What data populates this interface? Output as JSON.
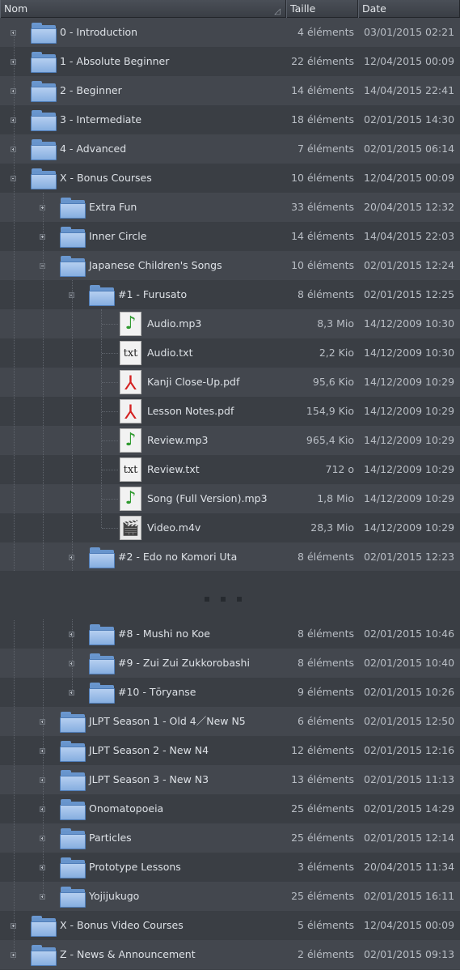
{
  "header": {
    "name": "Nom",
    "size": "Taille",
    "date": "Date",
    "sort_icon": "sort-indicator-icon"
  },
  "rows": [
    {
      "level": 0,
      "type": "folder",
      "toggle": "plus",
      "name": "0 - Introduction",
      "size": "4 éléments",
      "date": "03/01/2015 02:21"
    },
    {
      "level": 0,
      "type": "folder",
      "toggle": "plus",
      "name": "1 - Absolute Beginner",
      "size": "22 éléments",
      "date": "12/04/2015 00:09"
    },
    {
      "level": 0,
      "type": "folder",
      "toggle": "plus",
      "name": "2 - Beginner",
      "size": "14 éléments",
      "date": "14/04/2015 22:41"
    },
    {
      "level": 0,
      "type": "folder",
      "toggle": "plus",
      "name": "3 - Intermediate",
      "size": "18 éléments",
      "date": "02/01/2015 14:30"
    },
    {
      "level": 0,
      "type": "folder",
      "toggle": "plus",
      "name": "4 - Advanced",
      "size": "7 éléments",
      "date": "02/01/2015 06:14"
    },
    {
      "level": 0,
      "type": "folder",
      "toggle": "minus",
      "name": "X - Bonus Courses",
      "size": "10 éléments",
      "date": "12/04/2015 00:09"
    },
    {
      "level": 1,
      "type": "folder",
      "toggle": "plus",
      "name": "Extra Fun",
      "size": "33 éléments",
      "date": "20/04/2015 12:32"
    },
    {
      "level": 1,
      "type": "folder",
      "toggle": "plus",
      "name": "Inner Circle",
      "size": "14 éléments",
      "date": "14/04/2015 22:03"
    },
    {
      "level": 1,
      "type": "folder",
      "toggle": "minus",
      "name": "Japanese Children's Songs",
      "size": "10 éléments",
      "date": "02/01/2015 12:24"
    },
    {
      "level": 2,
      "type": "folder",
      "toggle": "minus",
      "name": "#1 - Furusato",
      "size": "8 éléments",
      "date": "02/01/2015 12:25"
    },
    {
      "level": 3,
      "type": "mp3",
      "name": "Audio.mp3",
      "size": "8,3 Mio",
      "date": "14/12/2009 10:30"
    },
    {
      "level": 3,
      "type": "txt",
      "name": "Audio.txt",
      "size": "2,2 Kio",
      "date": "14/12/2009 10:30"
    },
    {
      "level": 3,
      "type": "pdf",
      "name": "Kanji Close-Up.pdf",
      "size": "95,6 Kio",
      "date": "14/12/2009 10:29"
    },
    {
      "level": 3,
      "type": "pdf",
      "name": "Lesson Notes.pdf",
      "size": "154,9 Kio",
      "date": "14/12/2009 10:29"
    },
    {
      "level": 3,
      "type": "mp3",
      "name": "Review.mp3",
      "size": "965,4 Kio",
      "date": "14/12/2009 10:29"
    },
    {
      "level": 3,
      "type": "txt",
      "name": "Review.txt",
      "size": "712 o",
      "date": "14/12/2009 10:29"
    },
    {
      "level": 3,
      "type": "mp3",
      "name": "Song (Full Version).mp3",
      "size": "1,8 Mio",
      "date": "14/12/2009 10:29"
    },
    {
      "level": 3,
      "type": "m4v",
      "name": "Video.m4v",
      "size": "28,3 Mio",
      "date": "14/12/2009 10:29"
    },
    {
      "level": 2,
      "type": "folder",
      "toggle": "plus",
      "name": "#2 - Edo no Komori Uta",
      "size": "8 éléments",
      "date": "02/01/2015 12:23"
    },
    {
      "level": 2,
      "type": "folder",
      "toggle": "plus",
      "name": "#8 - Mushi no Koe",
      "size": "8 éléments",
      "date": "02/01/2015 10:46"
    },
    {
      "level": 2,
      "type": "folder",
      "toggle": "plus",
      "name": "#9 - Zui Zui Zukkorobashi",
      "size": "8 éléments",
      "date": "02/01/2015 10:40"
    },
    {
      "level": 2,
      "type": "folder",
      "toggle": "plus",
      "name": "#10 - Tōryanse",
      "size": "9 éléments",
      "date": "02/01/2015 10:26"
    },
    {
      "level": 1,
      "type": "folder",
      "toggle": "plus",
      "name": "JLPT Season 1 - Old 4／New N5",
      "size": "6 éléments",
      "date": "02/01/2015 12:50"
    },
    {
      "level": 1,
      "type": "folder",
      "toggle": "plus",
      "name": "JLPT Season 2 - New N4",
      "size": "12 éléments",
      "date": "02/01/2015 12:16"
    },
    {
      "level": 1,
      "type": "folder",
      "toggle": "plus",
      "name": "JLPT Season 3 - New N3",
      "size": "13 éléments",
      "date": "02/01/2015 11:13"
    },
    {
      "level": 1,
      "type": "folder",
      "toggle": "plus",
      "name": "Onomatopoeia",
      "size": "25 éléments",
      "date": "02/01/2015 14:29"
    },
    {
      "level": 1,
      "type": "folder",
      "toggle": "plus",
      "name": "Particles",
      "size": "25 éléments",
      "date": "02/01/2015 12:14"
    },
    {
      "level": 1,
      "type": "folder",
      "toggle": "plus",
      "name": "Prototype Lessons",
      "size": "3 éléments",
      "date": "20/04/2015 11:34"
    },
    {
      "level": 1,
      "type": "folder",
      "toggle": "plus",
      "name": "Yojijukugo",
      "size": "25 éléments",
      "date": "02/01/2015 16:11"
    },
    {
      "level": 0,
      "type": "folder",
      "toggle": "plus",
      "name": "X - Bonus Video Courses",
      "size": "5 éléments",
      "date": "12/04/2015 00:09"
    },
    {
      "level": 0,
      "type": "folder",
      "toggle": "plus",
      "name": "Z - News & Announcement",
      "size": "2 éléments",
      "date": "02/01/2015 09:13"
    }
  ],
  "gap_marker": "collapsed-rows-ellipsis"
}
